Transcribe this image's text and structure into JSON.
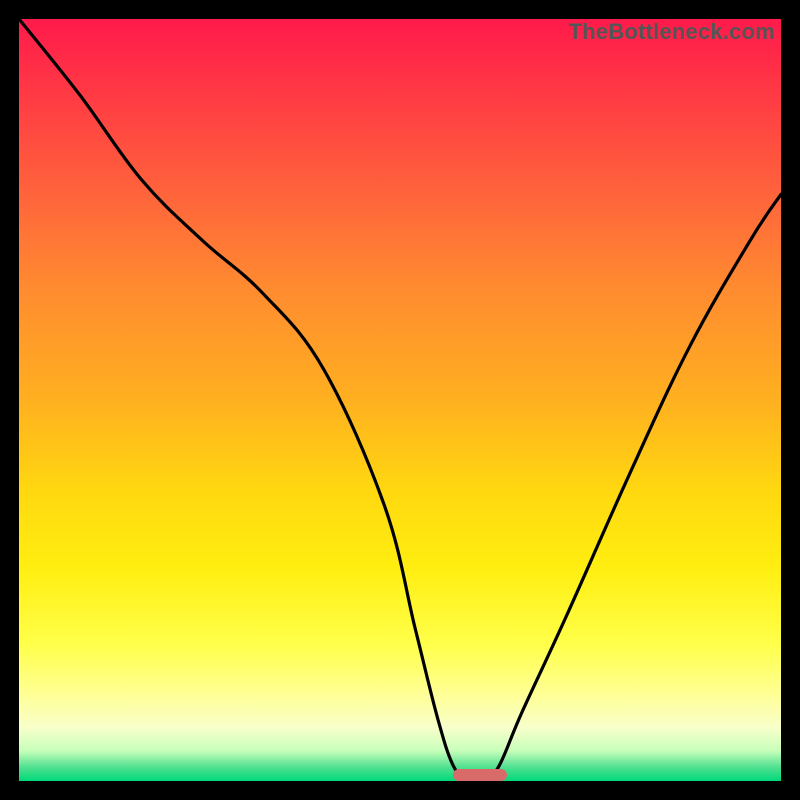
{
  "watermark": "TheBottleneck.com",
  "colors": {
    "black": "#000000",
    "curve": "#000000",
    "marker": "#d86a6a"
  },
  "chart_data": {
    "type": "line",
    "title": "",
    "xlabel": "",
    "ylabel": "",
    "xlim": [
      0,
      100
    ],
    "ylim": [
      0,
      100
    ],
    "grid": false,
    "series": [
      {
        "name": "bottleneck-curve",
        "x": [
          0,
          8,
          16,
          24,
          32,
          40,
          48,
          52,
          55,
          57,
          59,
          61,
          63,
          66,
          72,
          80,
          88,
          96,
          100
        ],
        "values": [
          100,
          90,
          79,
          71,
          64,
          54,
          36,
          20,
          8,
          2,
          0,
          0,
          2,
          9,
          22,
          40,
          57,
          71,
          77
        ]
      }
    ],
    "annotations": [
      {
        "name": "optimal-range-marker",
        "x_start": 57,
        "x_end": 64,
        "y": 0
      }
    ]
  }
}
